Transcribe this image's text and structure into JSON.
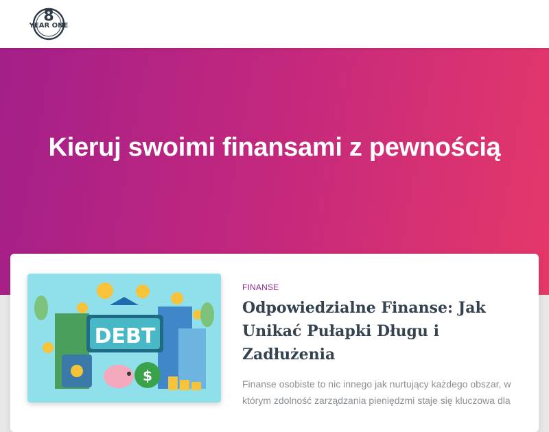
{
  "header": {
    "logo_text": "YEAR ONE",
    "logo_icon": "year-one-logo-icon"
  },
  "hero": {
    "title": "Kieruj swoimi finansami z pewnością"
  },
  "post": {
    "category": "FINANSE",
    "title": "Odpowiedzialne Finanse: Jak Unikać Pułapki Długu i Zadłużenia",
    "excerpt": "Finanse osobiste to nic innego jak nurtujący każdego obszar, w którym zdolność zarządzania pieniędzmi staje się kluczowa dla",
    "image": {
      "sign_text": "DEBT",
      "icon": "debt-illustration"
    }
  },
  "colors": {
    "hero_gradient_start": "#a31f89",
    "hero_gradient_end": "#e5386a",
    "category": "#8e2b8f",
    "title": "#34434f",
    "excerpt": "#8a8f94"
  }
}
